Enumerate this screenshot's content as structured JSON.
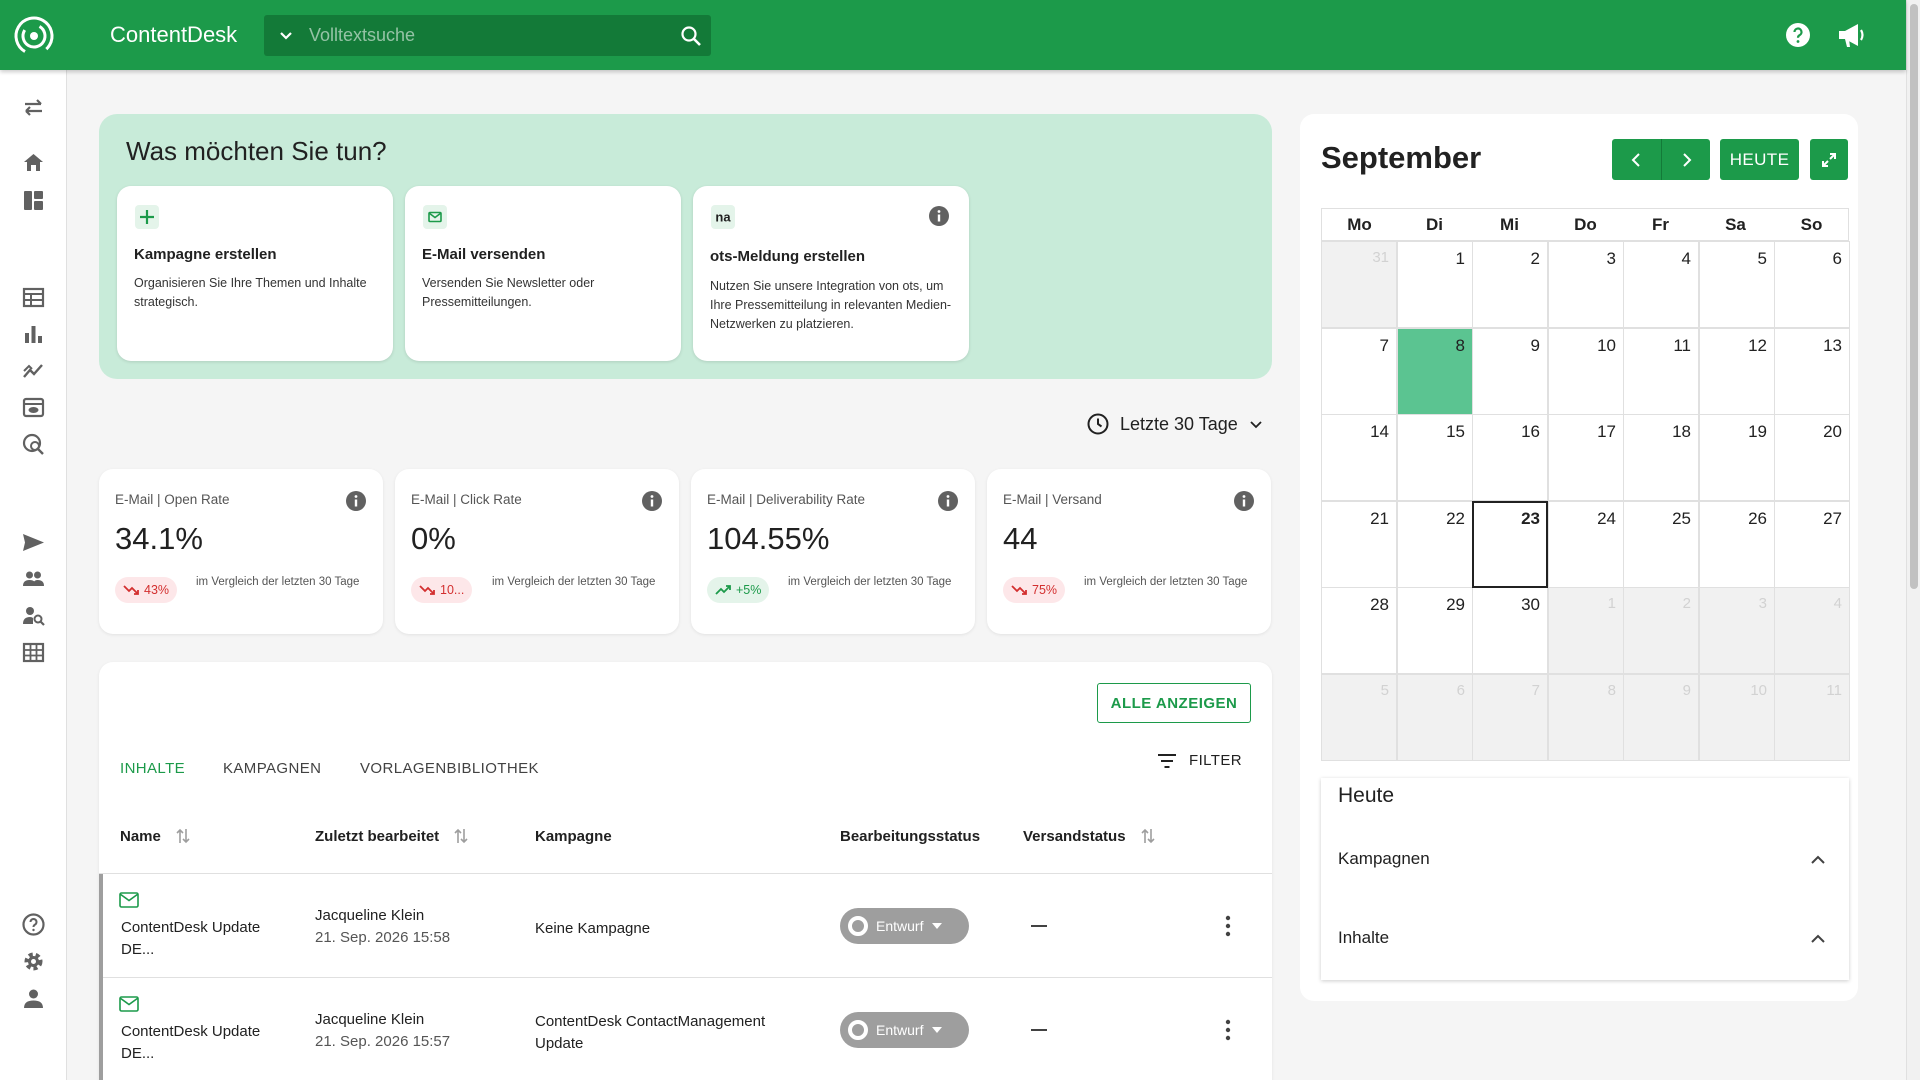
{
  "header": {
    "app_title": "ContentDesk",
    "search_placeholder": "Volltextsuche"
  },
  "actions": {
    "heading": "Was möchten Sie tun?",
    "cards": [
      {
        "title": "Kampagne erstellen",
        "desc": "Organisieren Sie Ihre Themen und Inhalte strategisch.",
        "icon": "plus-icon"
      },
      {
        "title": "E-Mail versenden",
        "desc": "Versenden Sie Newsletter oder Pressemitteilungen.",
        "icon": "mail-icon"
      },
      {
        "title": "ots-Meldung erstellen",
        "desc": "Nutzen Sie unsere Integration von ots, um Ihre Pressemitteilung in relevanten Medien-Netzwerken zu platzieren.",
        "icon": "na-logo-icon",
        "logo_text": "na"
      }
    ]
  },
  "period": {
    "label": "Letzte 30 Tage"
  },
  "kpis": [
    {
      "label": "E-Mail | Open Rate",
      "value": "34.1%",
      "badge": "43%",
      "trend": "down",
      "comparison": "im Vergleich der letzten 30 Tage"
    },
    {
      "label": "E-Mail | Click Rate",
      "value": "0%",
      "badge": "10...",
      "trend": "down",
      "comparison": "im Vergleich der letzten 30 Tage"
    },
    {
      "label": "E-Mail | Deliverability Rate",
      "value": "104.55%",
      "badge": "+5%",
      "trend": "up",
      "comparison": "im Vergleich der letzten 30 Tage"
    },
    {
      "label": "E-Mail | Versand",
      "value": "44",
      "badge": "75%",
      "trend": "down",
      "comparison": "im Vergleich der letzten 30 Tage"
    }
  ],
  "content": {
    "all_button": "ALLE ANZEIGEN",
    "tabs": [
      "INHALTE",
      "KAMPAGNEN",
      "VORLAGENBIBLIOTHEK"
    ],
    "active_tab": "INHALTE",
    "filter_label": "FILTER",
    "columns": [
      "Name",
      "Zuletzt bearbeitet",
      "Kampagne",
      "Bearbeitungsstatus",
      "Versandstatus"
    ],
    "rows": [
      {
        "name": "ContentDesk Update DE...",
        "editor": "Jacqueline Klein",
        "date": "21. Sep. 2026 15:58",
        "campaign": "Keine Kampagne",
        "status": "Entwurf",
        "shipping": "—"
      },
      {
        "name": "ContentDesk Update DE...",
        "editor": "Jacqueline Klein",
        "date": "21. Sep. 2026 15:57",
        "campaign": "ContentDesk ContactManagement Update",
        "status": "Entwurf",
        "shipping": "—"
      }
    ]
  },
  "calendar": {
    "month": "September",
    "today_button": "HEUTE",
    "weekdays": [
      "Mo",
      "Di",
      "Mi",
      "Do",
      "Fr",
      "Sa",
      "So"
    ],
    "weeks": [
      [
        "31",
        "1",
        "2",
        "3",
        "4",
        "5",
        "6"
      ],
      [
        "7",
        "8",
        "9",
        "10",
        "11",
        "12",
        "13"
      ],
      [
        "14",
        "15",
        "16",
        "17",
        "18",
        "19",
        "20"
      ],
      [
        "21",
        "22",
        "23",
        "24",
        "25",
        "26",
        "27"
      ],
      [
        "28",
        "29",
        "30",
        "1",
        "2",
        "3",
        "4"
      ],
      [
        "5",
        "6",
        "7",
        "8",
        "9",
        "10",
        "11"
      ]
    ],
    "selected_day": "8",
    "today_day": "23"
  },
  "today_panel": {
    "title": "Heute",
    "sections": [
      "Kampagnen",
      "Inhalte"
    ]
  },
  "colors": {
    "brand": "#1c9a4a",
    "panel_bg": "#c8ebd9",
    "selected_day": "#5bc491",
    "status_grey": "#9e9e9e"
  }
}
